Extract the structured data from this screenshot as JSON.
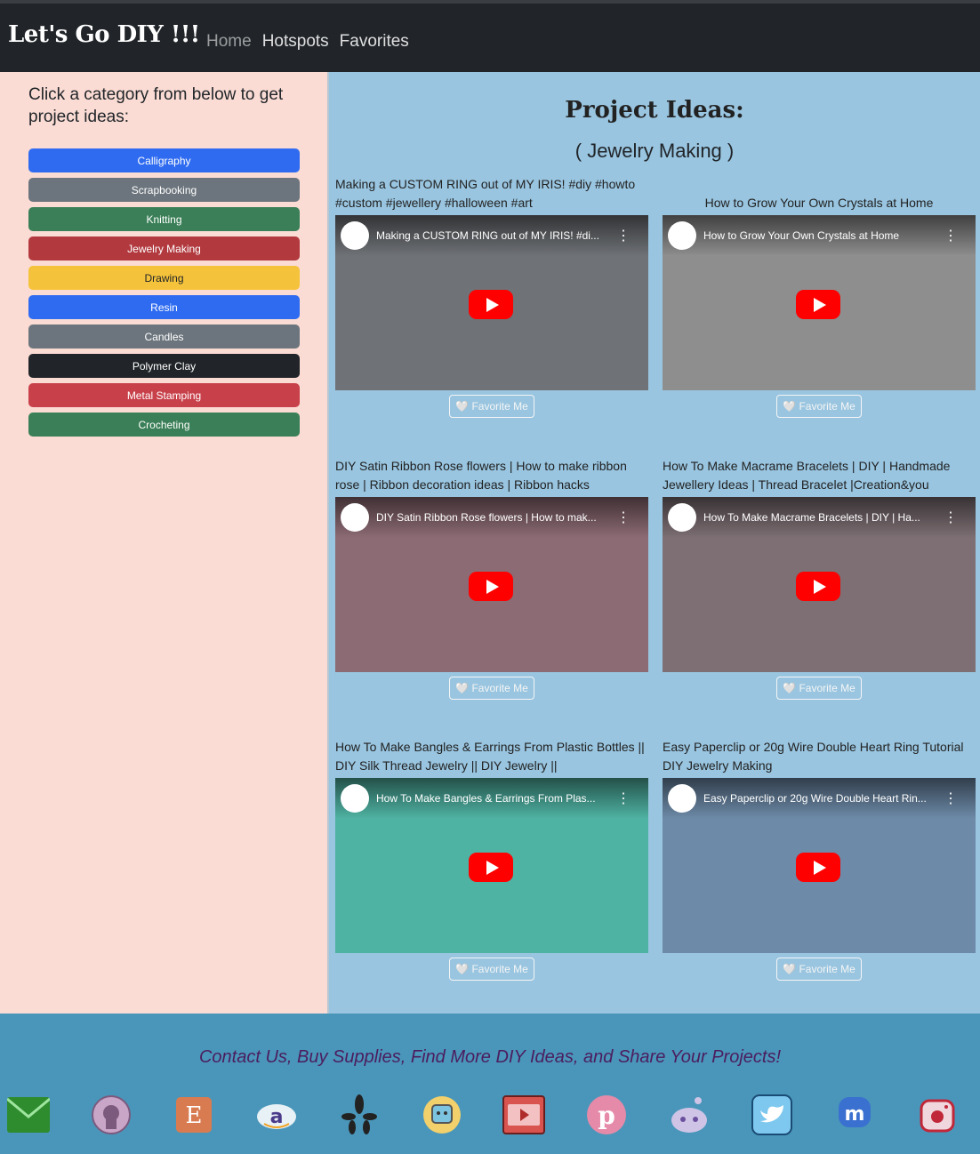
{
  "navbar": {
    "brand": "Let's Go DIY !!!",
    "links": [
      "Home",
      "Hotspots",
      "Favorites"
    ]
  },
  "sidebar": {
    "heading": "Click a category from below to get project ideas:",
    "categories": [
      {
        "label": "Calligraphy",
        "color": "#2f6bf0"
      },
      {
        "label": "Scrapbooking",
        "color": "#6c757d"
      },
      {
        "label": "Knitting",
        "color": "#3a7f57"
      },
      {
        "label": "Jewelry Making",
        "color": "#b23a3f"
      },
      {
        "label": "Drawing",
        "color": "#f5c33b"
      },
      {
        "label": "Resin",
        "color": "#2f6bf0"
      },
      {
        "label": "Candles",
        "color": "#6c757d"
      },
      {
        "label": "Polymer Clay",
        "color": "#212529"
      },
      {
        "label": "Metal Stamping",
        "color": "#c8404a"
      },
      {
        "label": "Crocheting",
        "color": "#3a7f57"
      }
    ]
  },
  "content": {
    "title": "Project Ideas:",
    "subtitle": "( Jewelry Making )",
    "fav_label": "🤍 Favorite Me",
    "videos": [
      {
        "title": "Making a CUSTOM RING out of MY IRIS! #diy #howto #custom #jewellery #halloween #art",
        "overlay": "Making a CUSTOM RING out of MY IRIS! #di...",
        "bg": "#6f7276"
      },
      {
        "title": "How to Grow Your Own Crystals at Home",
        "overlay": "How to Grow Your Own Crystals at Home",
        "bg": "#8e8e8e"
      },
      {
        "title": "DIY Satin Ribbon Rose flowers | How to make ribbon rose | Ribbon decoration ideas | Ribbon hacks",
        "overlay": "DIY Satin Ribbon Rose flowers | How to mak...",
        "bg": "#8d6b74"
      },
      {
        "title": "How To Make Macrame Bracelets | DIY | Handmade Jewellery Ideas | Thread Bracelet |Creation&you",
        "overlay": "How To Make Macrame Bracelets | DIY | Ha...",
        "bg": "#7d6f73"
      },
      {
        "title": "How To Make Bangles & Earrings From Plastic Bottles || DIY Silk Thread Jewelry || DIY Jewelry ||",
        "overlay": "How To Make Bangles & Earrings From Plas...",
        "bg": "#4fb3a3"
      },
      {
        "title": "Easy Paperclip or 20g Wire Double Heart Ring Tutorial DIY Jewelry Making",
        "overlay": "Easy Paperclip or 20g Wire Double Heart Rin...",
        "bg": "#6d8aa8"
      }
    ]
  },
  "footer": {
    "tagline": "Contact Us, Buy Supplies, Find More DIY Ideas, and Share Your Projects!",
    "icons": [
      "mail-icon",
      "github-icon",
      "etsy-icon",
      "amazon-icon",
      "yelp-icon",
      "app-icon",
      "youtube-icon",
      "pinterest-icon",
      "reddit-icon",
      "twitter-icon",
      "mastodon-icon",
      "instagram-icon"
    ]
  }
}
